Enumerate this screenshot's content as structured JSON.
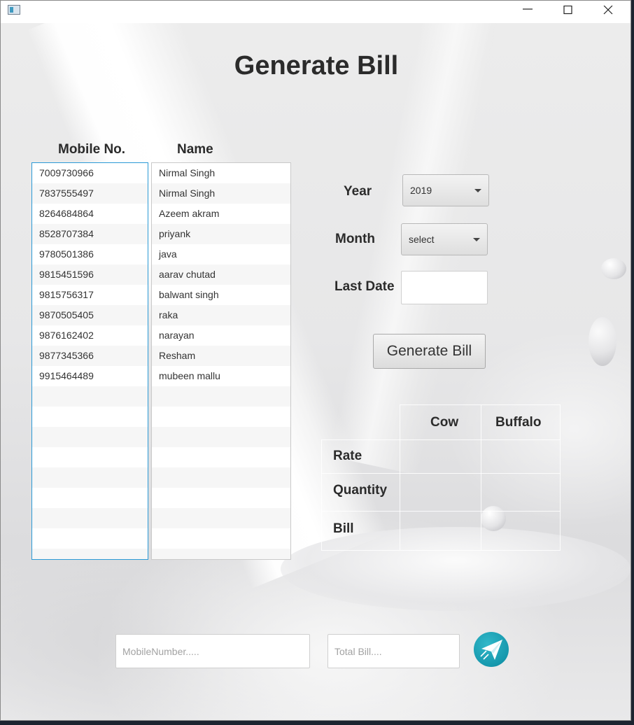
{
  "window": {
    "title": "",
    "controls": {
      "minimize": "minimize-icon",
      "maximize": "maximize-icon",
      "close": "close-icon"
    }
  },
  "page": {
    "title": "Generate Bill"
  },
  "customers": {
    "mobile_header": "Mobile No.",
    "name_header": "Name",
    "rows": [
      {
        "mobile": "7009730966",
        "name": "Nirmal Singh"
      },
      {
        "mobile": "7837555497",
        "name": "Nirmal Singh"
      },
      {
        "mobile": "8264684864",
        "name": "Azeem akram"
      },
      {
        "mobile": "8528707384",
        "name": "priyank"
      },
      {
        "mobile": "9780501386",
        "name": "java"
      },
      {
        "mobile": "9815451596",
        "name": "aarav chutad"
      },
      {
        "mobile": "9815756317",
        "name": "balwant singh"
      },
      {
        "mobile": "9870505405",
        "name": "raka"
      },
      {
        "mobile": "9876162402",
        "name": "narayan"
      },
      {
        "mobile": "9877345366",
        "name": "Resham"
      },
      {
        "mobile": "9915464489",
        "name": "mubeen mallu"
      }
    ]
  },
  "form": {
    "year_label": "Year",
    "year_value": "2019",
    "month_label": "Month",
    "month_value": "select",
    "last_date_label": "Last Date",
    "last_date_value": "",
    "generate_button": "Generate Bill"
  },
  "bill_table": {
    "columns": [
      "Cow",
      "Buffalo"
    ],
    "rows": [
      {
        "label": "Rate",
        "cow": "",
        "buffalo": ""
      },
      {
        "label": "Quantity",
        "cow": "",
        "buffalo": ""
      },
      {
        "label": "Bill",
        "cow": "",
        "buffalo": ""
      }
    ]
  },
  "footer": {
    "mobile_placeholder": "MobileNumber.....",
    "total_placeholder": "Total Bill....",
    "send_icon": "send-icon"
  },
  "colors": {
    "list_focus_border": "#2b9ad6",
    "send_button": "#1698ad"
  }
}
